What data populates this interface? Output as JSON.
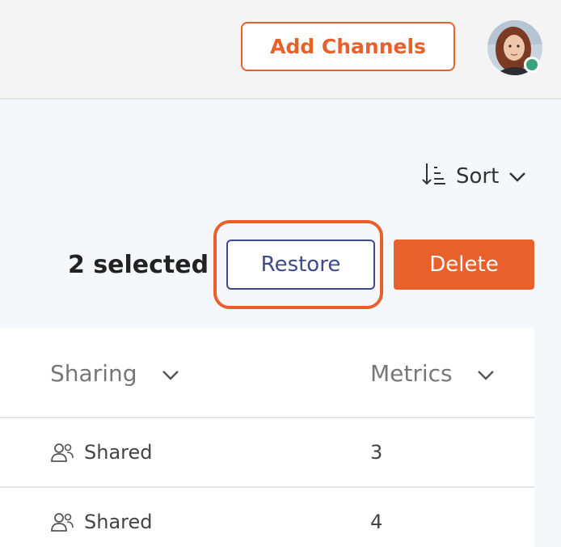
{
  "header": {
    "add_channels_label": "Add Channels"
  },
  "toolbar": {
    "sort_label": "Sort",
    "selected_text": "2 selected",
    "restore_label": "Restore",
    "delete_label": "Delete"
  },
  "table": {
    "columns": [
      {
        "label": "Sharing"
      },
      {
        "label": "Metrics"
      }
    ],
    "rows": [
      {
        "sharing": "Shared",
        "metrics": "3"
      },
      {
        "sharing": "Shared",
        "metrics": "4"
      }
    ]
  },
  "colors": {
    "accent": "#e8612c",
    "primary": "#3c4a8c",
    "status_online": "#3aa17e"
  },
  "icons": [
    "sort-icon",
    "chevron-down-icon",
    "users-icon",
    "avatar"
  ]
}
